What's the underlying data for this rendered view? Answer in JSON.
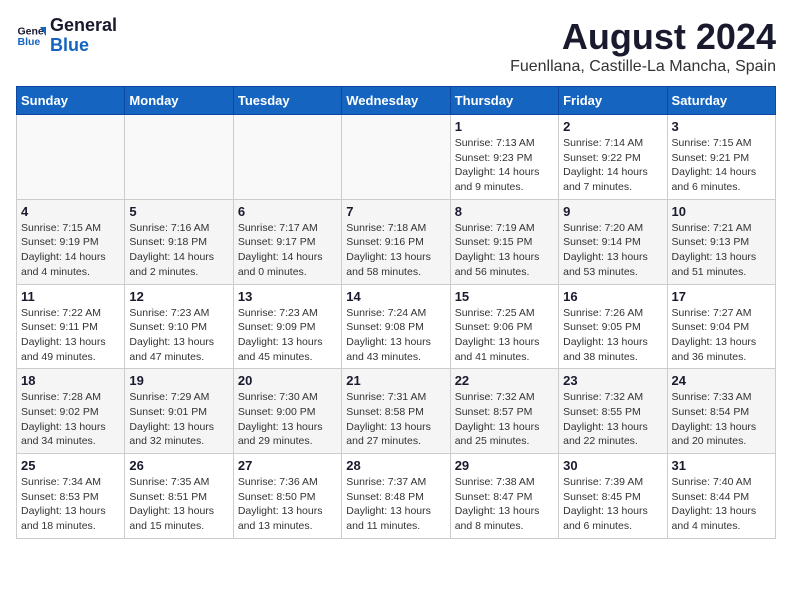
{
  "header": {
    "logo_line1": "General",
    "logo_line2": "Blue",
    "month_year": "August 2024",
    "location": "Fuenllana, Castille-La Mancha, Spain"
  },
  "days_of_week": [
    "Sunday",
    "Monday",
    "Tuesday",
    "Wednesday",
    "Thursday",
    "Friday",
    "Saturday"
  ],
  "weeks": [
    [
      {
        "day": "",
        "info": ""
      },
      {
        "day": "",
        "info": ""
      },
      {
        "day": "",
        "info": ""
      },
      {
        "day": "",
        "info": ""
      },
      {
        "day": "1",
        "info": "Sunrise: 7:13 AM\nSunset: 9:23 PM\nDaylight: 14 hours\nand 9 minutes."
      },
      {
        "day": "2",
        "info": "Sunrise: 7:14 AM\nSunset: 9:22 PM\nDaylight: 14 hours\nand 7 minutes."
      },
      {
        "day": "3",
        "info": "Sunrise: 7:15 AM\nSunset: 9:21 PM\nDaylight: 14 hours\nand 6 minutes."
      }
    ],
    [
      {
        "day": "4",
        "info": "Sunrise: 7:15 AM\nSunset: 9:19 PM\nDaylight: 14 hours\nand 4 minutes."
      },
      {
        "day": "5",
        "info": "Sunrise: 7:16 AM\nSunset: 9:18 PM\nDaylight: 14 hours\nand 2 minutes."
      },
      {
        "day": "6",
        "info": "Sunrise: 7:17 AM\nSunset: 9:17 PM\nDaylight: 14 hours\nand 0 minutes."
      },
      {
        "day": "7",
        "info": "Sunrise: 7:18 AM\nSunset: 9:16 PM\nDaylight: 13 hours\nand 58 minutes."
      },
      {
        "day": "8",
        "info": "Sunrise: 7:19 AM\nSunset: 9:15 PM\nDaylight: 13 hours\nand 56 minutes."
      },
      {
        "day": "9",
        "info": "Sunrise: 7:20 AM\nSunset: 9:14 PM\nDaylight: 13 hours\nand 53 minutes."
      },
      {
        "day": "10",
        "info": "Sunrise: 7:21 AM\nSunset: 9:13 PM\nDaylight: 13 hours\nand 51 minutes."
      }
    ],
    [
      {
        "day": "11",
        "info": "Sunrise: 7:22 AM\nSunset: 9:11 PM\nDaylight: 13 hours\nand 49 minutes."
      },
      {
        "day": "12",
        "info": "Sunrise: 7:23 AM\nSunset: 9:10 PM\nDaylight: 13 hours\nand 47 minutes."
      },
      {
        "day": "13",
        "info": "Sunrise: 7:23 AM\nSunset: 9:09 PM\nDaylight: 13 hours\nand 45 minutes."
      },
      {
        "day": "14",
        "info": "Sunrise: 7:24 AM\nSunset: 9:08 PM\nDaylight: 13 hours\nand 43 minutes."
      },
      {
        "day": "15",
        "info": "Sunrise: 7:25 AM\nSunset: 9:06 PM\nDaylight: 13 hours\nand 41 minutes."
      },
      {
        "day": "16",
        "info": "Sunrise: 7:26 AM\nSunset: 9:05 PM\nDaylight: 13 hours\nand 38 minutes."
      },
      {
        "day": "17",
        "info": "Sunrise: 7:27 AM\nSunset: 9:04 PM\nDaylight: 13 hours\nand 36 minutes."
      }
    ],
    [
      {
        "day": "18",
        "info": "Sunrise: 7:28 AM\nSunset: 9:02 PM\nDaylight: 13 hours\nand 34 minutes."
      },
      {
        "day": "19",
        "info": "Sunrise: 7:29 AM\nSunset: 9:01 PM\nDaylight: 13 hours\nand 32 minutes."
      },
      {
        "day": "20",
        "info": "Sunrise: 7:30 AM\nSunset: 9:00 PM\nDaylight: 13 hours\nand 29 minutes."
      },
      {
        "day": "21",
        "info": "Sunrise: 7:31 AM\nSunset: 8:58 PM\nDaylight: 13 hours\nand 27 minutes."
      },
      {
        "day": "22",
        "info": "Sunrise: 7:32 AM\nSunset: 8:57 PM\nDaylight: 13 hours\nand 25 minutes."
      },
      {
        "day": "23",
        "info": "Sunrise: 7:32 AM\nSunset: 8:55 PM\nDaylight: 13 hours\nand 22 minutes."
      },
      {
        "day": "24",
        "info": "Sunrise: 7:33 AM\nSunset: 8:54 PM\nDaylight: 13 hours\nand 20 minutes."
      }
    ],
    [
      {
        "day": "25",
        "info": "Sunrise: 7:34 AM\nSunset: 8:53 PM\nDaylight: 13 hours\nand 18 minutes."
      },
      {
        "day": "26",
        "info": "Sunrise: 7:35 AM\nSunset: 8:51 PM\nDaylight: 13 hours\nand 15 minutes."
      },
      {
        "day": "27",
        "info": "Sunrise: 7:36 AM\nSunset: 8:50 PM\nDaylight: 13 hours\nand 13 minutes."
      },
      {
        "day": "28",
        "info": "Sunrise: 7:37 AM\nSunset: 8:48 PM\nDaylight: 13 hours\nand 11 minutes."
      },
      {
        "day": "29",
        "info": "Sunrise: 7:38 AM\nSunset: 8:47 PM\nDaylight: 13 hours\nand 8 minutes."
      },
      {
        "day": "30",
        "info": "Sunrise: 7:39 AM\nSunset: 8:45 PM\nDaylight: 13 hours\nand 6 minutes."
      },
      {
        "day": "31",
        "info": "Sunrise: 7:40 AM\nSunset: 8:44 PM\nDaylight: 13 hours\nand 4 minutes."
      }
    ]
  ]
}
